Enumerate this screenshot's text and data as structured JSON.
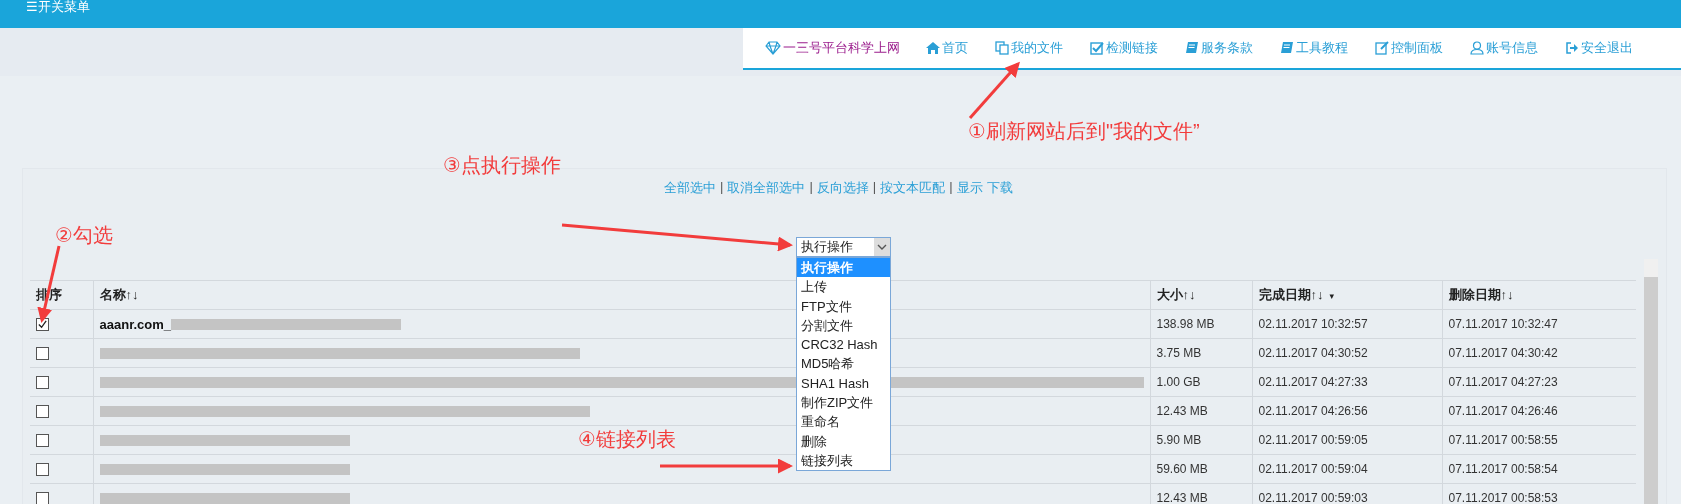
{
  "menu_toggle": {
    "label": "☰开关菜单"
  },
  "nav": {
    "brand": "一三号平台科学上网",
    "items": [
      {
        "kind": "home",
        "label": "首页"
      },
      {
        "kind": "files",
        "label": "我的文件"
      },
      {
        "kind": "check",
        "label": "检测链接"
      },
      {
        "kind": "book",
        "label": "服务条款"
      },
      {
        "kind": "book",
        "label": "工具教程"
      },
      {
        "kind": "edit",
        "label": "控制面板"
      },
      {
        "kind": "user",
        "label": "账号信息"
      },
      {
        "kind": "exit",
        "label": "安全退出"
      }
    ]
  },
  "annotations": [
    {
      "kind": "nav",
      "text": "①刷新网站后到\"我的文件”"
    },
    {
      "kind": "check",
      "text": "②勾选"
    },
    {
      "kind": "select",
      "text": "③点执行操作"
    },
    {
      "kind": "option",
      "text": "④链接列表"
    }
  ],
  "selection_links": {
    "separator": "|",
    "groups": [
      [
        "全部选中"
      ],
      [
        "取消全部选中"
      ],
      [
        "反向选择"
      ],
      [
        "按文本匹配"
      ],
      [
        "显示",
        "下载"
      ]
    ]
  },
  "action_select": {
    "value": "执行操作",
    "options": [
      {
        "label": "执行操作",
        "selected": true
      },
      {
        "label": "上传",
        "selected": false
      },
      {
        "label": "FTP文件",
        "selected": false
      },
      {
        "label": "分割文件",
        "selected": false
      },
      {
        "label": "CRC32 Hash",
        "selected": false
      },
      {
        "label": "MD5哈希",
        "selected": false
      },
      {
        "label": "SHA1 Hash",
        "selected": false
      },
      {
        "label": "制作ZIP文件",
        "selected": false
      },
      {
        "label": "重命名",
        "selected": false
      },
      {
        "label": "删除",
        "selected": false
      },
      {
        "label": "链接列表",
        "selected": false
      }
    ]
  },
  "table": {
    "columns": [
      {
        "label": "排序",
        "sorted": false
      },
      {
        "label": "名称↑↓",
        "sorted": false
      },
      {
        "label": "大小↑↓",
        "sorted": false
      },
      {
        "label": "完成日期↑↓",
        "sorted": true
      },
      {
        "label": "删除日期↑↓",
        "sorted": false
      }
    ],
    "sort_mark": "▾",
    "rows": [
      {
        "checked": true,
        "name": "aaanr.com_",
        "size": "138.98 MB",
        "completed": "02.11.2017 10:32:57",
        "deleted": "07.11.2017 10:32:47"
      },
      {
        "checked": false,
        "size": "3.75 MB",
        "completed": "02.11.2017 04:30:52",
        "deleted": "07.11.2017 04:30:42"
      },
      {
        "checked": false,
        "size": "1.00 GB",
        "completed": "02.11.2017 04:27:33",
        "deleted": "07.11.2017 04:27:23"
      },
      {
        "checked": false,
        "size": "12.43 MB",
        "completed": "02.11.2017 04:26:56",
        "deleted": "07.11.2017 04:26:46"
      },
      {
        "checked": false,
        "size": "5.90 MB",
        "completed": "02.11.2017 00:59:05",
        "deleted": "07.11.2017 00:58:55"
      },
      {
        "checked": false,
        "size": "59.60 MB",
        "completed": "02.11.2017 00:59:04",
        "deleted": "07.11.2017 00:58:54"
      },
      {
        "checked": false,
        "size": "12.43 MB",
        "completed": "02.11.2017 00:59:03",
        "deleted": "07.11.2017 00:58:53"
      }
    ]
  }
}
